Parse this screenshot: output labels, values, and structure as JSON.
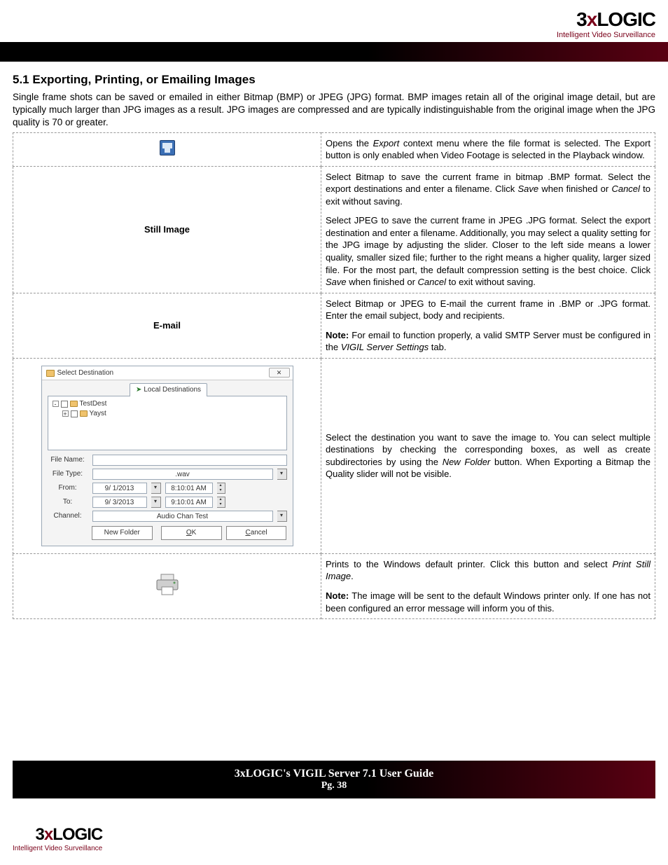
{
  "brand": {
    "part1": "3",
    "partX": "x",
    "part2": "LOGIC",
    "tagline": "Intelligent Video Surveillance"
  },
  "section": {
    "title": "5.1 Exporting, Printing, or Emailing Images",
    "intro": "Single frame shots can be saved or emailed in either Bitmap (BMP) or JPEG (JPG) format. BMP images retain all of the original image detail, but are typically much larger than JPG images as a result. JPG images are compressed and are typically indistinguishable from the original image when the JPG quality is 70 or greater."
  },
  "rows": {
    "export_icon": {
      "p1a": "Opens the ",
      "p1_em": "Export",
      "p1b": " context menu where the file format is selected.  The Export button is only enabled when Video Footage is selected in the Playback window."
    },
    "still": {
      "label": "Still Image",
      "p1a": "Select Bitmap to save the current frame in bitmap .BMP format.  Select the export destinations and enter a filename.  Click ",
      "p1_em1": "Save",
      "p1b": " when finished or ",
      "p1_em2": "Cancel",
      "p1c": " to exit without saving.",
      "p2a": "Select JPEG to save the current frame in JPEG .JPG format.  Select the export destination and enter a filename. Additionally, you may select a quality setting for the JPG image by adjusting the slider. Closer to the left side means a lower quality, smaller sized file; further to the right means a higher quality, larger sized file. For the most part, the default compression setting is the best choice. Click ",
      "p2_em1": "Save",
      "p2b": " when finished or ",
      "p2_em2": "Cancel",
      "p2c": " to exit without saving."
    },
    "email": {
      "label": "E-mail",
      "p1": "Select Bitmap or JPEG to E-mail the current frame in .BMP or .JPG format. Enter the email subject, body and recipients.",
      "note_label": "Note:",
      "note_a": " For email to function properly, a valid SMTP Server must be configured in the ",
      "note_em": "VIGIL Server Settings",
      "note_b": " tab."
    },
    "dest": {
      "p1a": "Select the destination you want to save the image to. You can select multiple destinations by checking the corresponding boxes, as well as create subdirectories by using the ",
      "p1_em": "New Folder",
      "p1b": " button.  When Exporting a Bitmap the Quality slider will not be visible."
    },
    "print": {
      "p1a": "Prints to the Windows default printer. Click this button and select ",
      "p1_em": "Print Still Image",
      "p1b": ".",
      "note_label": "Note:",
      "note": " The image will be sent to the default Windows printer only. If one has not been configured an error message will inform you of this."
    }
  },
  "dialog": {
    "title": "Select Destination",
    "close": "✕",
    "tab": "Local Destinations",
    "tree": {
      "root": "TestDest",
      "child": "Yayst"
    },
    "labels": {
      "filename": "File Name:",
      "filetype": "File Type:",
      "from": "From:",
      "to": "To:",
      "channel": "Channel:"
    },
    "values": {
      "filetype": ".wav",
      "from_date": "9/ 1/2013",
      "from_time": "8:10:01 AM",
      "to_date": "9/ 3/2013",
      "to_time": "9:10:01 AM",
      "channel": "Audio Chan Test"
    },
    "buttons": {
      "new_folder": "New Folder",
      "ok": "OK",
      "cancel": "Cancel"
    }
  },
  "footer": {
    "title": "3xLOGIC's VIGIL Server 7.1 User Guide",
    "page": "Pg. 38"
  }
}
